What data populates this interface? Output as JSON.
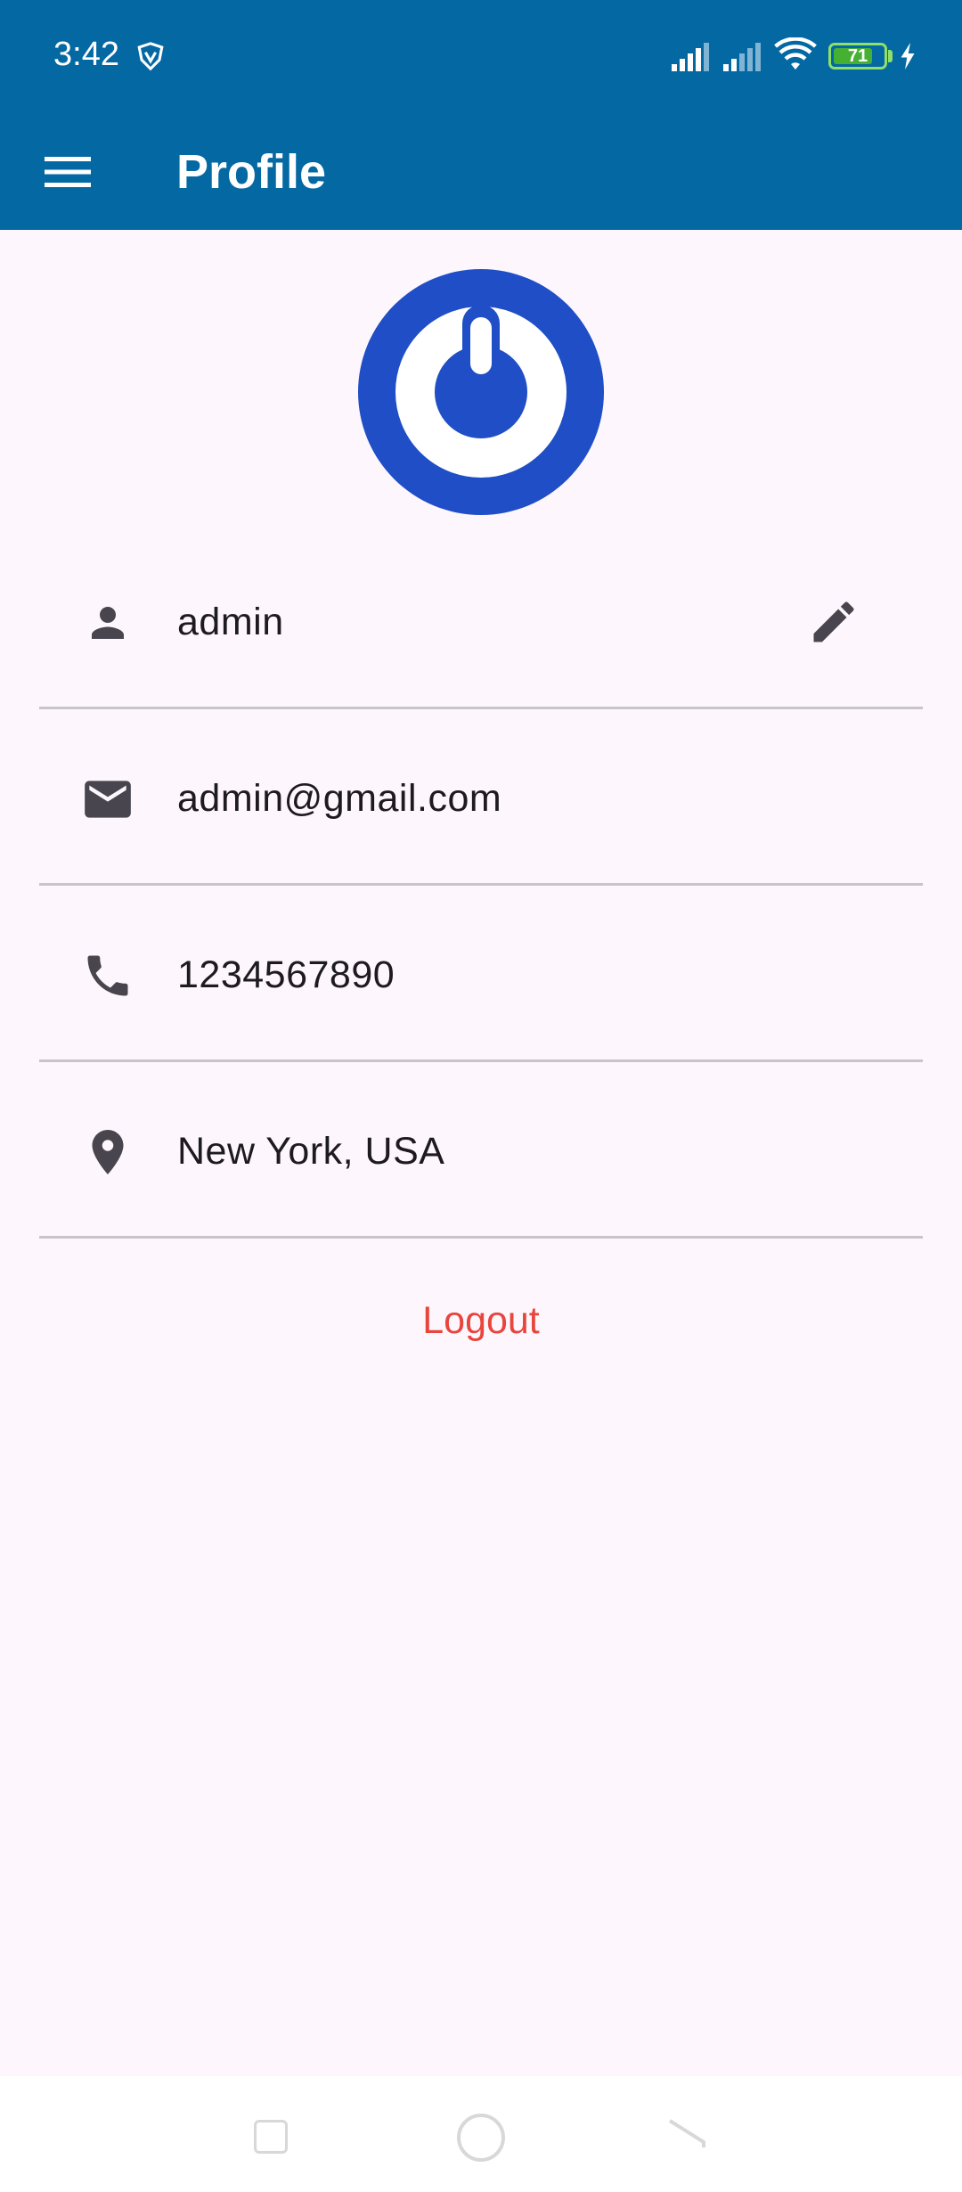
{
  "status_bar": {
    "time": "3:42",
    "battery_level": "71",
    "icons": [
      "vpn-shield-icon",
      "signal-icon",
      "signal-icon",
      "wifi-icon",
      "battery-icon",
      "charging-bolt-icon"
    ]
  },
  "app_bar": {
    "title": "Profile",
    "menu_icon": "hamburger-menu-icon"
  },
  "profile": {
    "avatar_icon": "power-logo-icon",
    "rows": [
      {
        "icon": "person-icon",
        "value": "admin"
      },
      {
        "icon": "email-icon",
        "value": "admin@gmail.com"
      },
      {
        "icon": "phone-icon",
        "value": "1234567890"
      },
      {
        "icon": "location-pin-icon",
        "value": "New York, USA"
      }
    ],
    "edit_icon": "pencil-icon"
  },
  "logout_label": "Logout",
  "colors": {
    "header": "#0468a3",
    "background": "#fdf7fd",
    "avatar": "#1f4ec6",
    "logout": "#e8453c",
    "icon": "#49454f"
  },
  "nav_bar": {
    "icons": [
      "recent-apps-icon",
      "home-icon",
      "back-icon"
    ]
  }
}
